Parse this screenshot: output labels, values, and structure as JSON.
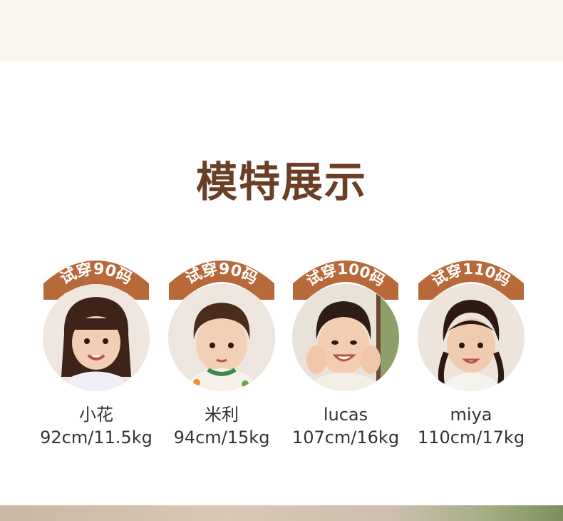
{
  "section": {
    "title": "模特展示"
  },
  "models": [
    {
      "badge": "试穿90码",
      "name": "小花",
      "stats": "92cm/11.5kg"
    },
    {
      "badge": "试穿90码",
      "name": "米利",
      "stats": "94cm/15kg"
    },
    {
      "badge": "试穿100码",
      "name": "lucas",
      "stats": "107cm/16kg"
    },
    {
      "badge": "试穿110码",
      "name": "miya",
      "stats": "110cm/17kg"
    }
  ],
  "colors": {
    "badge": "#b8693a",
    "title": "#6a3f26",
    "text": "#333333",
    "top_band": "#f8f4ee"
  }
}
